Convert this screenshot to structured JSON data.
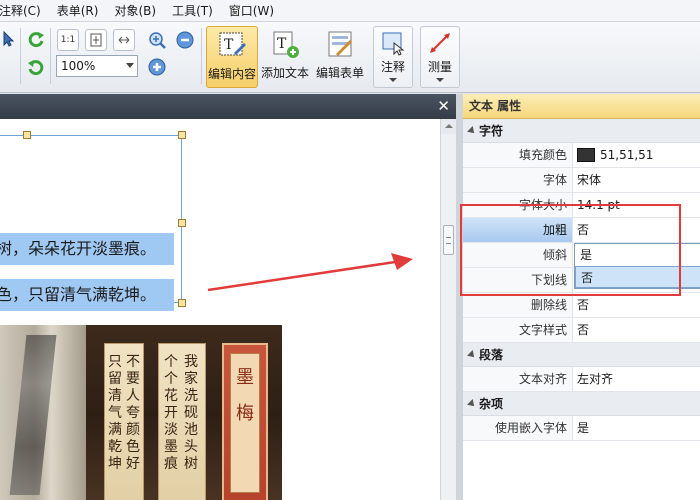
{
  "menu": [
    "注释(C)",
    "表单(R)",
    "对象(B)",
    "工具(T)",
    "窗口(W)"
  ],
  "toolbar": {
    "zoom_value": "100%",
    "fit_label": "1:1",
    "edit_content": "编辑内容",
    "add_text": "添加文本",
    "edit_form": "编辑表单",
    "annotate": "注释",
    "measure": "测量"
  },
  "document": {
    "line1": "树，朵朵花开淡墨痕。",
    "line2": "色，只留清气满乾坤。",
    "book_columns": [
      "只留清气满乾坤",
      "不要人夸颜色好",
      "个个花开淡墨痕",
      "我家洗砚池头树"
    ],
    "book_title": "墨梅"
  },
  "properties": {
    "title": "文本 属性",
    "groups": {
      "char": "字符",
      "para": "段落",
      "misc": "杂项"
    },
    "rows": {
      "fill_color": {
        "label": "填充颜色",
        "value": "51,51,51"
      },
      "font": {
        "label": "字体",
        "value": "宋体"
      },
      "font_size": {
        "label": "字体大小",
        "value": "14.1 pt"
      },
      "bold": {
        "label": "加粗",
        "value": "否"
      },
      "italic": {
        "label": "倾斜",
        "value": ""
      },
      "underline": {
        "label": "下划线",
        "value": ""
      },
      "strikethrough": {
        "label": "删除线",
        "value": "否"
      },
      "text_style": {
        "label": "文字样式",
        "value": "否"
      },
      "text_align": {
        "label": "文本对齐",
        "value": "左对齐"
      },
      "embed_font": {
        "label": "使用嵌入字体",
        "value": "是"
      }
    },
    "dropdown": [
      "是",
      "否"
    ]
  },
  "colors": {
    "accent_red": "#e23b3b",
    "fill_swatch": "#333333"
  }
}
